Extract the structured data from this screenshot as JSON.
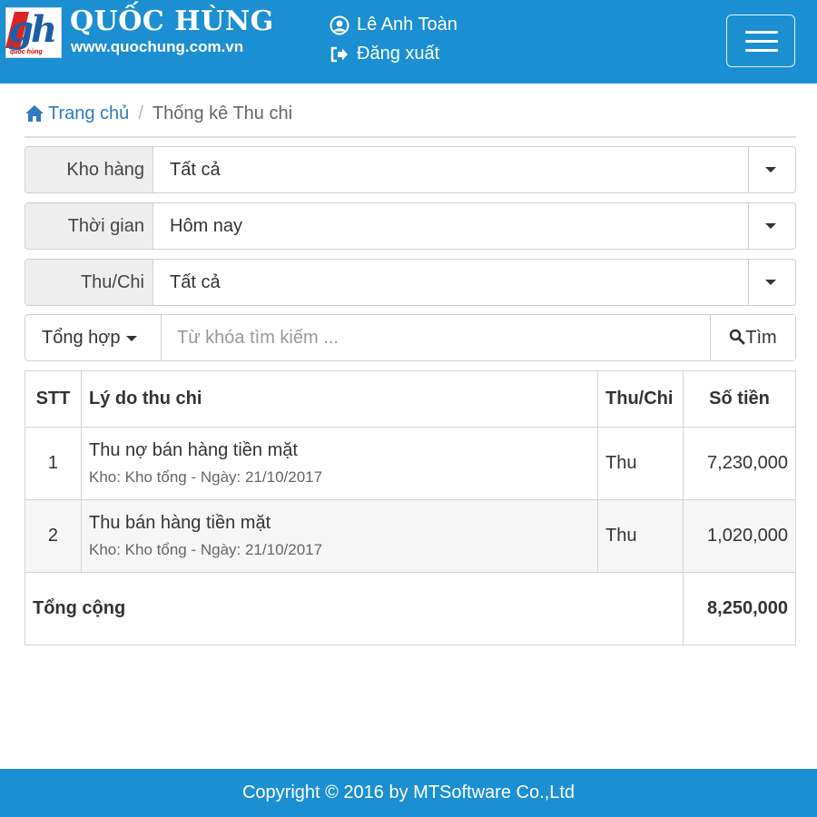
{
  "header": {
    "logo_text": "gh",
    "logo_tagline": "quốc hùng",
    "brand": "QUỐC HÙNG",
    "url": "www.quochung.com.vn",
    "user_name": "Lê Anh Toàn",
    "logout_label": "Đăng xuất"
  },
  "breadcrumb": {
    "home": "Trang chủ",
    "separator": "/",
    "current": "Thống kê Thu chi"
  },
  "filters": [
    {
      "label": "Kho hàng",
      "value": "Tất cả"
    },
    {
      "label": "Thời gian",
      "value": "Hôm nay"
    },
    {
      "label": "Thu/Chi",
      "value": "Tất cả"
    }
  ],
  "search": {
    "mode": "Tổng hợp",
    "placeholder": "Từ khóa tìm kiếm ...",
    "button": "Tìm"
  },
  "table": {
    "headers": [
      "STT",
      "Lý do thu chi",
      "Thu/Chi",
      "Số tiền"
    ],
    "rows": [
      {
        "stt": "1",
        "reason": "Thu nợ bán hàng tiền mặt",
        "detail": "Kho: Kho tổng - Ngày: 21/10/2017",
        "type": "Thu",
        "amount": "7,230,000"
      },
      {
        "stt": "2",
        "reason": "Thu bán hàng tiền mặt",
        "detail": "Kho: Kho tổng - Ngày: 21/10/2017",
        "type": "Thu",
        "amount": "1,020,000"
      }
    ],
    "total_label": "Tổng cộng",
    "total_amount": "8,250,000"
  },
  "footer": {
    "copyright": "Copyright © 2016 by MTSoftware Co.,Ltd"
  },
  "colors": {
    "brand_blue": "#1b8fd1",
    "link_blue": "#2f7bc0"
  }
}
